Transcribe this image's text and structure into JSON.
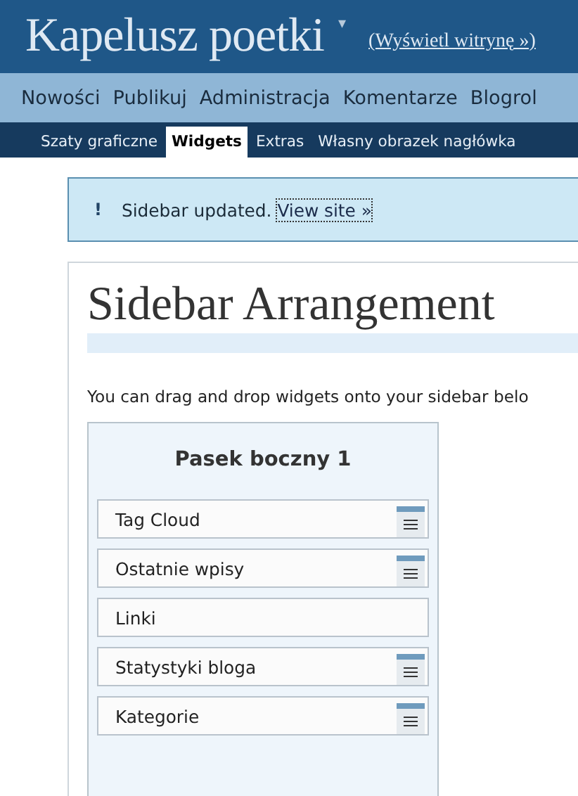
{
  "header": {
    "site_title": "Kapelusz poetki",
    "dropdown_glyph": "▾",
    "view_site_link": "(Wyświetl witrynę »)"
  },
  "main_menu": [
    {
      "label": "Nowości"
    },
    {
      "label": "Publikuj"
    },
    {
      "label": "Administracja"
    },
    {
      "label": "Komentarze"
    },
    {
      "label": "Blogrol"
    }
  ],
  "sub_menu": [
    {
      "label": "Szaty graficzne",
      "selected": false
    },
    {
      "label": "Widgets",
      "selected": true
    },
    {
      "label": "Extras",
      "selected": false
    },
    {
      "label": "Własny obrazek nagłówka",
      "selected": false
    }
  ],
  "notice": {
    "icon_glyph": "!",
    "message": "Sidebar updated.",
    "link": "View site »"
  },
  "page_title": "Sidebar Arrangement",
  "intro": "You can drag and drop widgets onto your sidebar belo",
  "sidebar": {
    "title": "Pasek boczny 1",
    "widgets": [
      {
        "name": "Tag Cloud",
        "has_handle": true
      },
      {
        "name": "Ostatnie wpisy",
        "has_handle": true
      },
      {
        "name": "Linki",
        "has_handle": false
      },
      {
        "name": "Statystyki bloga",
        "has_handle": true
      },
      {
        "name": "Kategorie",
        "has_handle": true
      }
    ]
  }
}
